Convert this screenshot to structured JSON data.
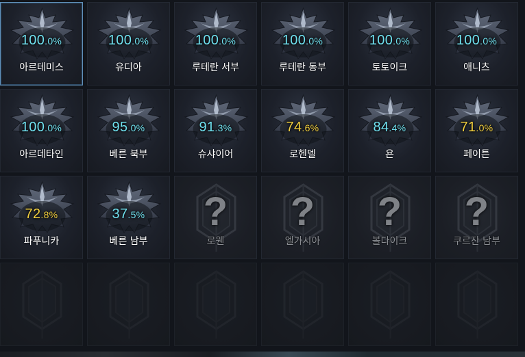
{
  "regions": [
    {
      "name": "아르테미스",
      "int": "100",
      "dec": ".0%",
      "state": "full",
      "selected": true
    },
    {
      "name": "유디아",
      "int": "100",
      "dec": ".0%",
      "state": "full"
    },
    {
      "name": "루테란 서부",
      "int": "100",
      "dec": ".0%",
      "state": "full"
    },
    {
      "name": "루테란 동부",
      "int": "100",
      "dec": ".0%",
      "state": "full"
    },
    {
      "name": "토토이크",
      "int": "100",
      "dec": ".0%",
      "state": "full"
    },
    {
      "name": "애니츠",
      "int": "100",
      "dec": ".0%",
      "state": "full"
    },
    {
      "name": "아르데타인",
      "int": "100",
      "dec": ".0%",
      "state": "full"
    },
    {
      "name": "베른 북부",
      "int": "95",
      "dec": ".0%",
      "state": "full"
    },
    {
      "name": "슈샤이어",
      "int": "91",
      "dec": ".3%",
      "state": "full"
    },
    {
      "name": "로헨델",
      "int": "74",
      "dec": ".6%",
      "state": "partial"
    },
    {
      "name": "욘",
      "int": "84",
      "dec": ".4%",
      "state": "full"
    },
    {
      "name": "페이튼",
      "int": "71",
      "dec": ".0%",
      "state": "partial"
    },
    {
      "name": "파푸니카",
      "int": "72",
      "dec": ".8%",
      "state": "partial"
    },
    {
      "name": "베른 남부",
      "int": "37",
      "dec": ".5%",
      "state": "full"
    },
    {
      "name": "로웬",
      "state": "locked",
      "mark": "?"
    },
    {
      "name": "엘가시아",
      "state": "locked",
      "mark": "?"
    },
    {
      "name": "볼다이크",
      "state": "locked",
      "mark": "?"
    },
    {
      "name": "쿠르잔 남부",
      "state": "locked",
      "mark": "?"
    }
  ],
  "colors": {
    "full_percent": "#6fe0ee",
    "partial_percent": "#f2cf3d",
    "locked_text": "#8a8d92",
    "selected_border": "#5f8fb8"
  },
  "icons": {
    "emblem": "region-emblem-icon",
    "locked": "question-mark-icon"
  }
}
